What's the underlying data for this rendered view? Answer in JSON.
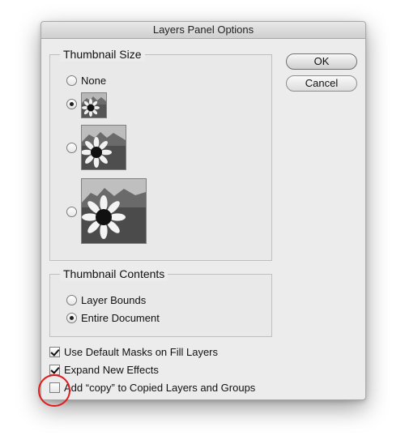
{
  "dialog": {
    "title": "Layers Panel Options",
    "buttons": {
      "ok": "OK",
      "cancel": "Cancel"
    },
    "thumbnail_size": {
      "label": "Thumbnail Size",
      "options": [
        {
          "label": "None",
          "selected": false
        },
        {
          "label": "",
          "selected": true
        },
        {
          "label": "",
          "selected": false
        },
        {
          "label": "",
          "selected": false
        }
      ]
    },
    "thumbnail_contents": {
      "label": "Thumbnail Contents",
      "options": [
        {
          "label": "Layer Bounds",
          "selected": false
        },
        {
          "label": "Entire Document",
          "selected": true
        }
      ]
    },
    "checkboxes": [
      {
        "label": "Use Default Masks on Fill Layers",
        "checked": true
      },
      {
        "label": "Expand New Effects",
        "checked": true
      },
      {
        "label": "Add “copy” to Copied Layers and Groups",
        "checked": false
      }
    ]
  },
  "colors": {
    "dialog_bg": "#ececec",
    "highlight": "#e11b1b"
  }
}
